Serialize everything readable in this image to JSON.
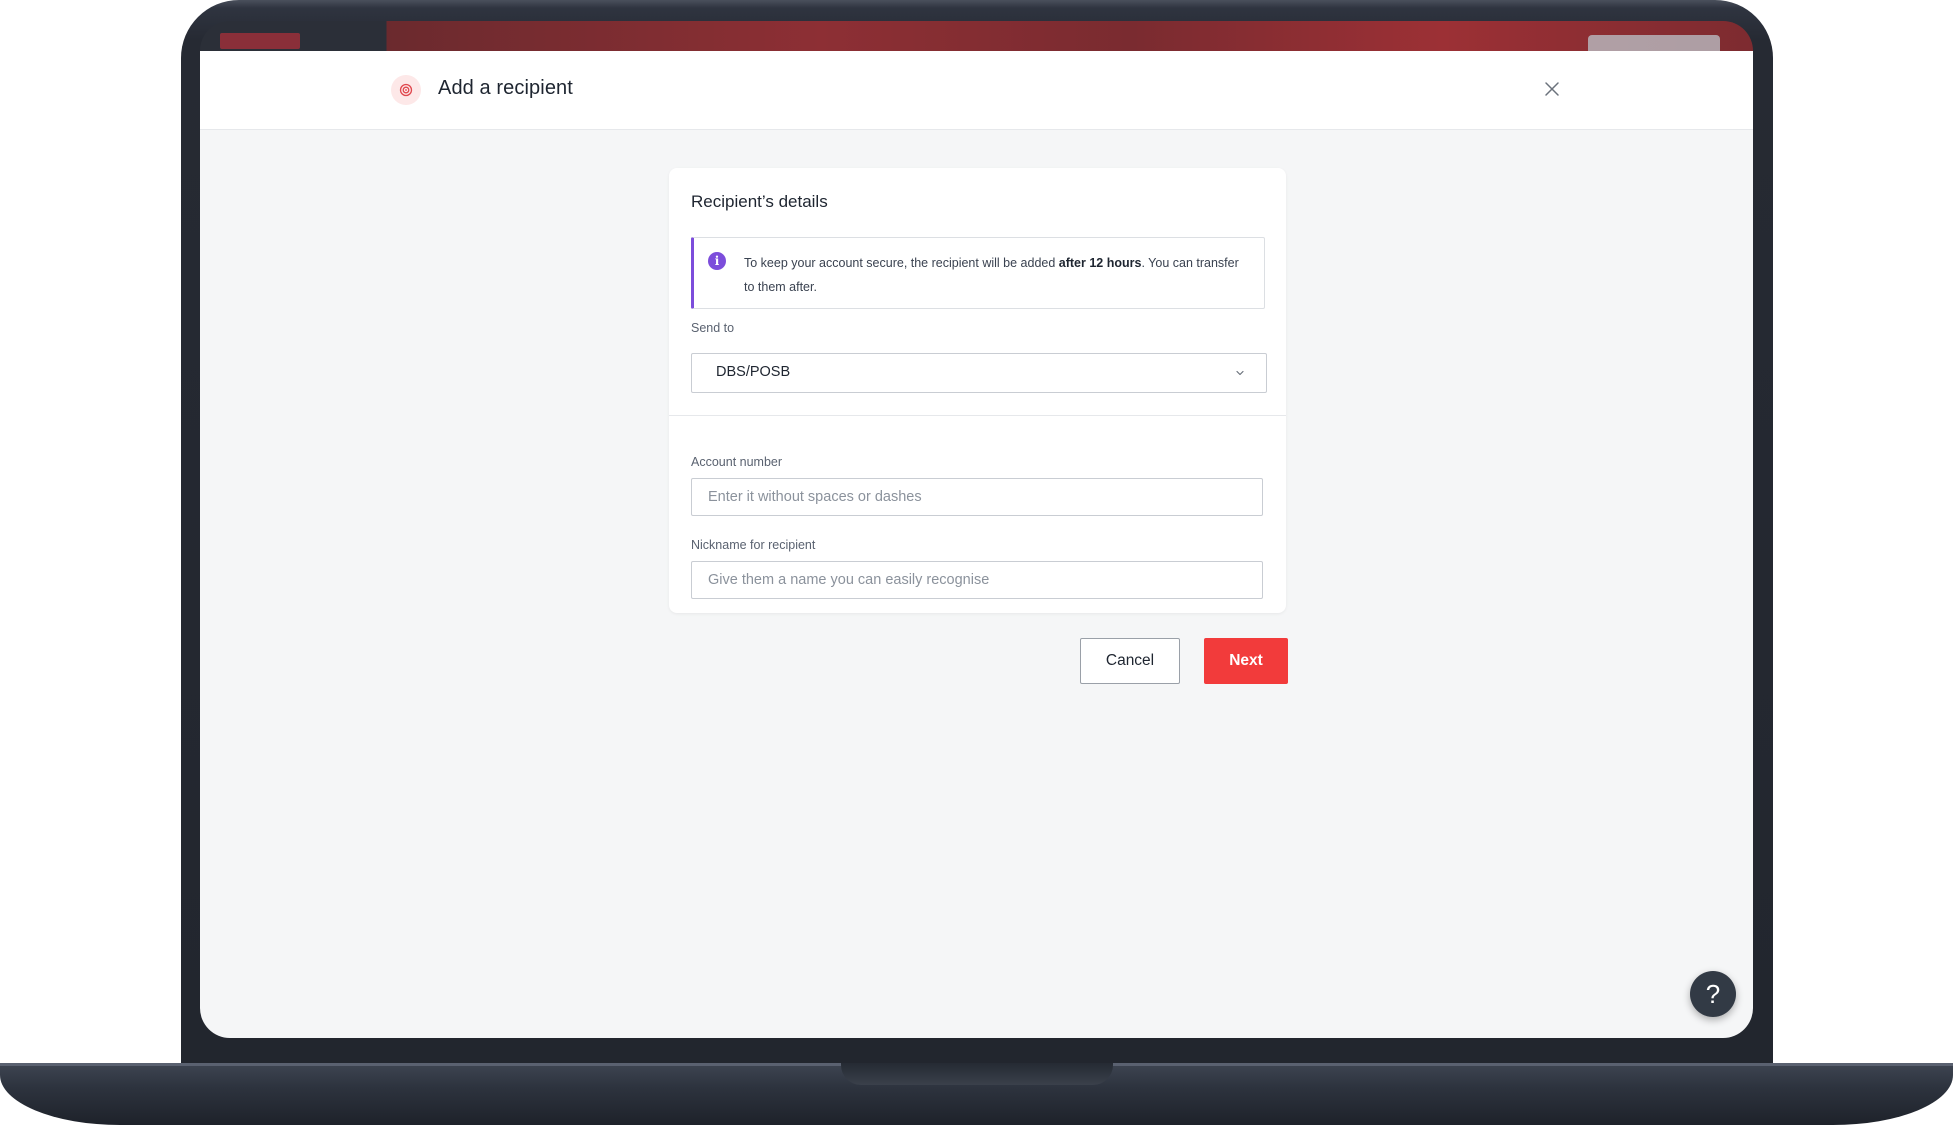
{
  "modal": {
    "title": "Add a recipient",
    "header_icon": "target-icon",
    "close_icon": "close-icon"
  },
  "card": {
    "title": "Recipient’s details",
    "info": {
      "icon": "info-icon",
      "text_before": "To keep your account secure, the recipient will be added ",
      "text_bold": "after 12 hours",
      "text_after": ". You can transfer to them after."
    },
    "send_to": {
      "label": "Send to",
      "value": "DBS/POSB",
      "icon": "chevron-down-icon"
    },
    "account_number": {
      "label": "Account number",
      "value": "",
      "placeholder": "Enter it without spaces or dashes"
    },
    "nickname": {
      "label": "Nickname for recipient",
      "value": "",
      "placeholder": "Give them a name you can easily recognise"
    }
  },
  "actions": {
    "cancel_label": "Cancel",
    "next_label": "Next"
  },
  "help": {
    "label": "?",
    "icon": "help-icon"
  },
  "colors": {
    "accent_red": "#f23b3b",
    "info_purple": "#7c4ddb",
    "page_background": "#f5f6f7",
    "help_button": "#323a45"
  }
}
